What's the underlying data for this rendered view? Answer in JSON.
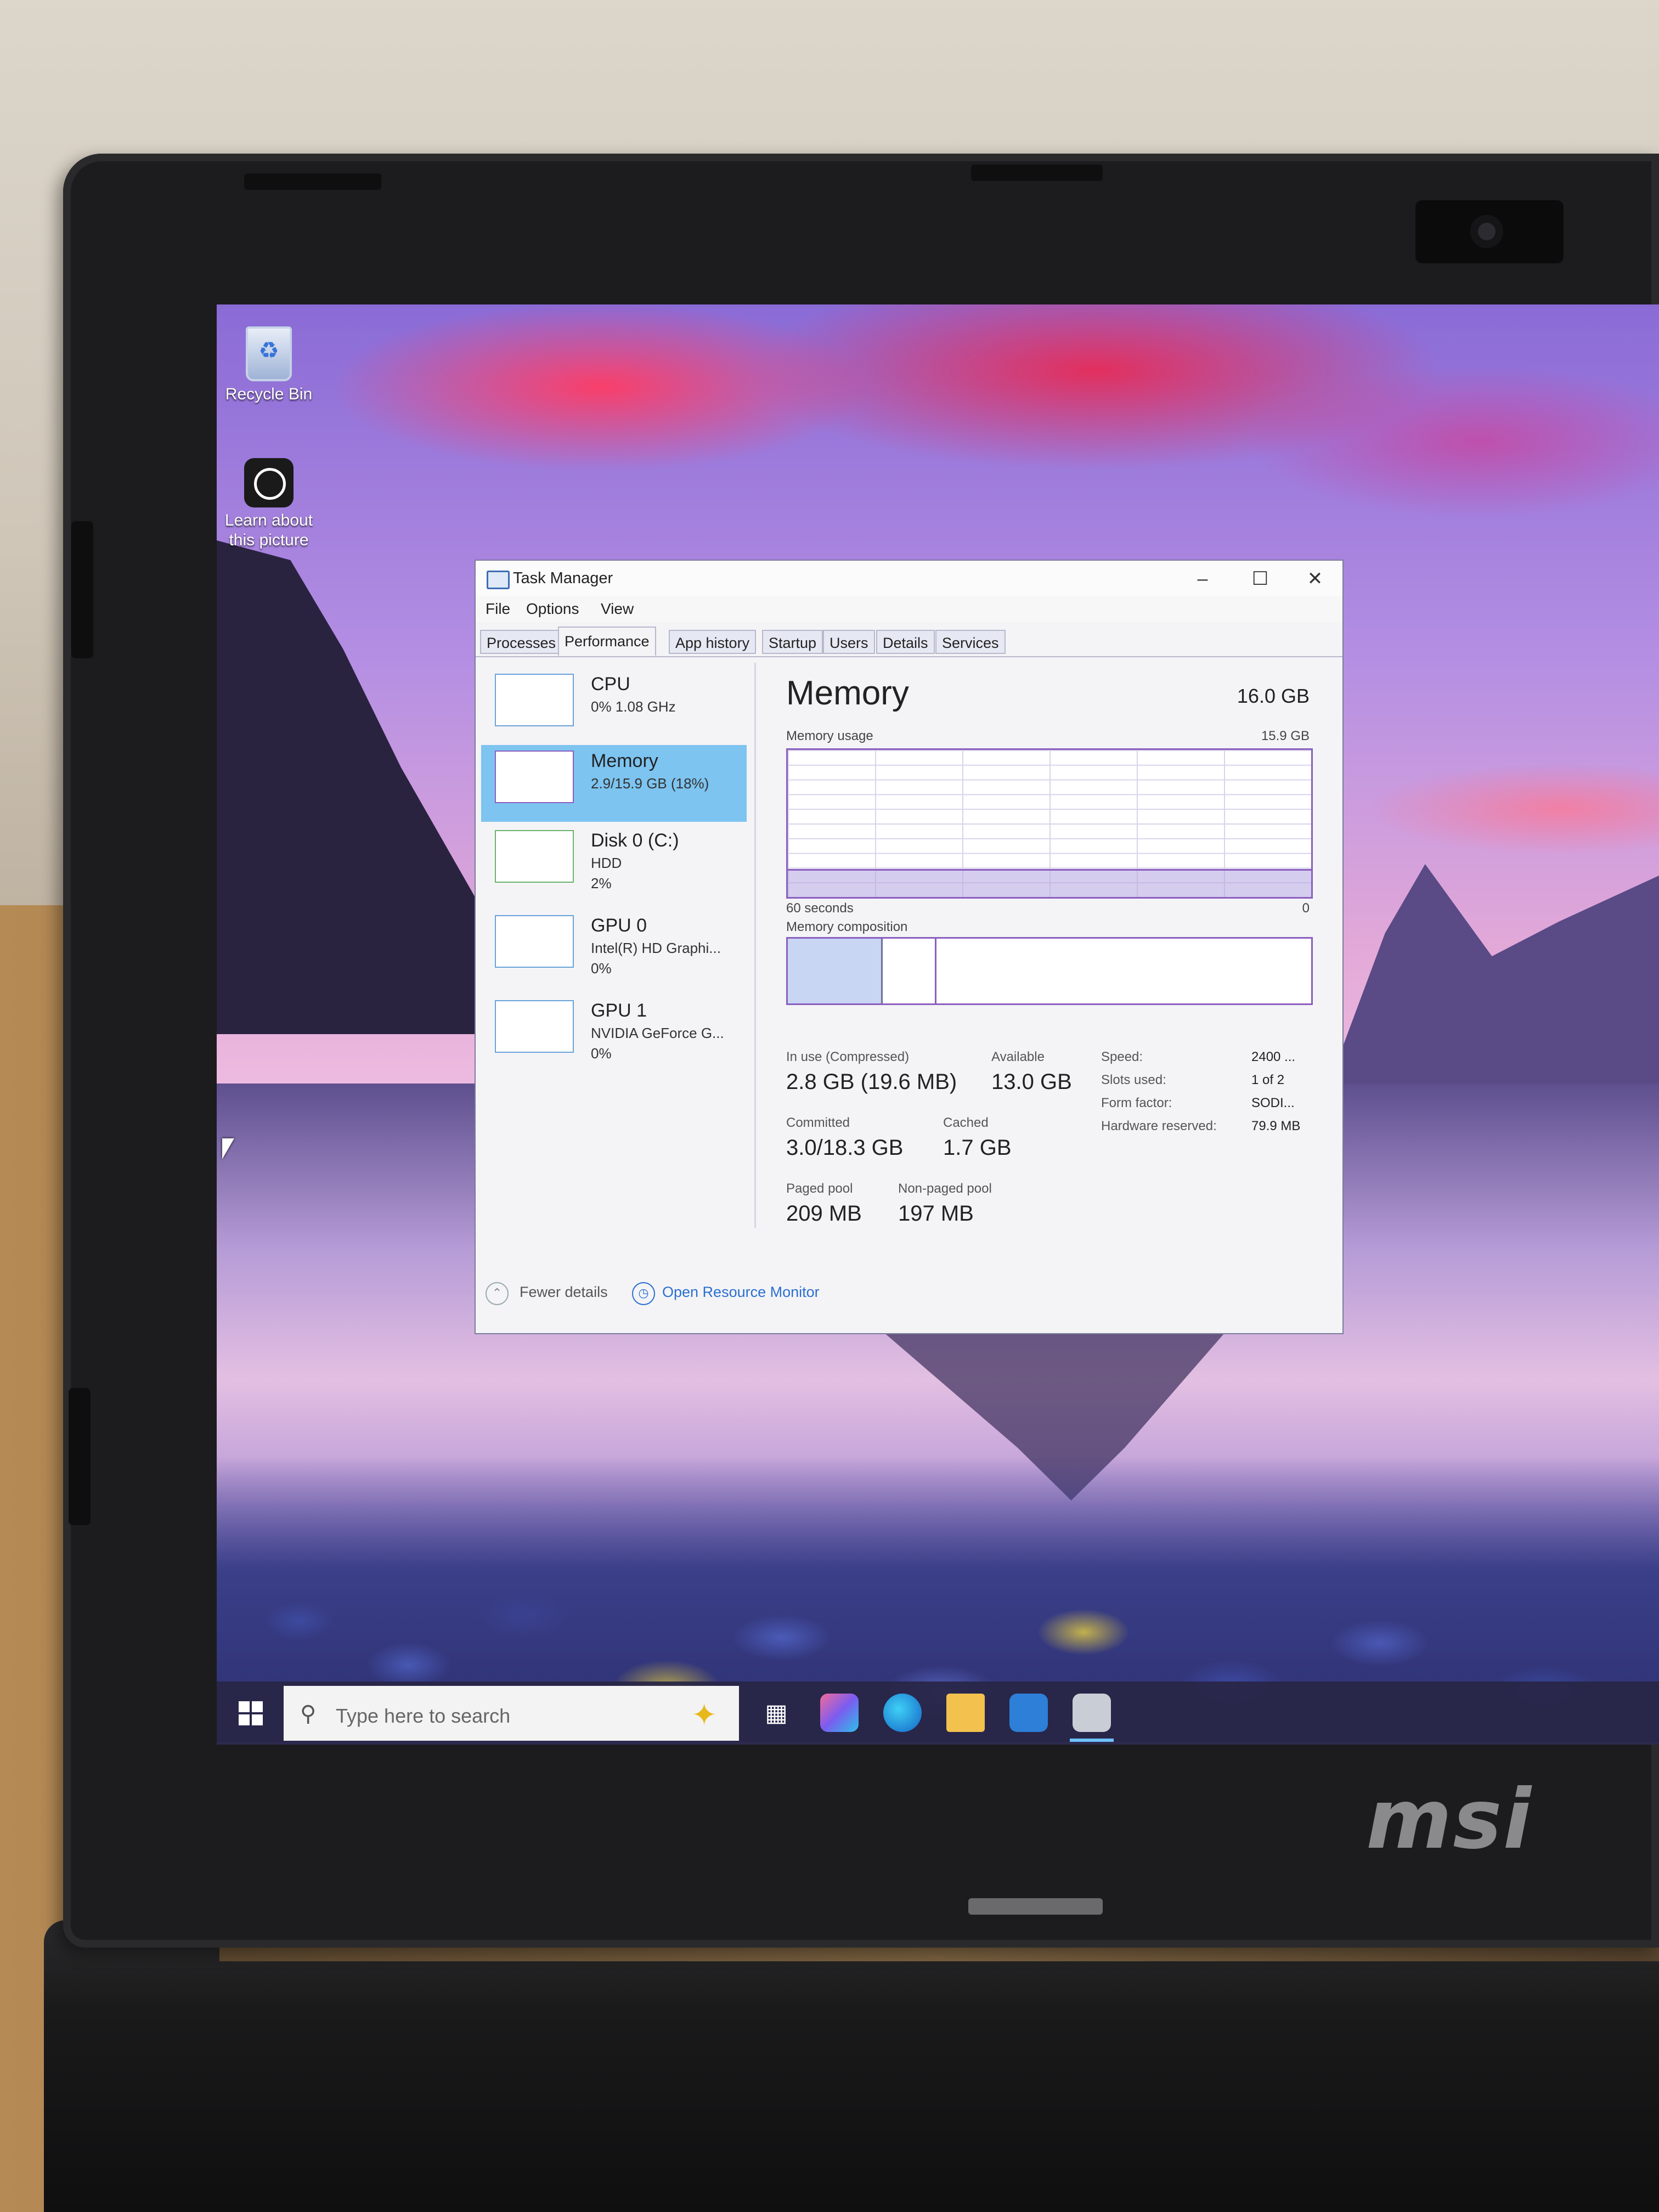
{
  "desktop": {
    "icons": [
      {
        "label": "Recycle Bin"
      },
      {
        "label": "Learn about this picture"
      }
    ]
  },
  "task_manager": {
    "title": "Task Manager",
    "menu": [
      "File",
      "Options",
      "View"
    ],
    "tabs": [
      "Processes",
      "Performance",
      "App history",
      "Startup",
      "Users",
      "Details",
      "Services"
    ],
    "active_tab": "Performance",
    "sidebar": [
      {
        "name": "CPU",
        "line1": "0% 1.08 GHz",
        "line2": ""
      },
      {
        "name": "Memory",
        "line1": "2.9/15.9 GB (18%)",
        "line2": "",
        "selected": true
      },
      {
        "name": "Disk 0 (C:)",
        "line1": "HDD",
        "line2": "2%"
      },
      {
        "name": "GPU 0",
        "line1": "Intel(R) HD Graphi...",
        "line2": "0%"
      },
      {
        "name": "GPU 1",
        "line1": "NVIDIA GeForce G...",
        "line2": "0%"
      }
    ],
    "memory": {
      "title": "Memory",
      "total": "16.0 GB",
      "usage_label": "Memory usage",
      "usage_max": "15.9 GB",
      "graph_left": "60 seconds",
      "graph_right": "0",
      "usage_fraction": 0.18,
      "composition_label": "Memory composition",
      "in_use_label": "In use (Compressed)",
      "in_use_value": "2.8 GB (19.6 MB)",
      "available_label": "Available",
      "available_value": "13.0 GB",
      "committed_label": "Committed",
      "committed_value": "3.0/18.3 GB",
      "cached_label": "Cached",
      "cached_value": "1.7 GB",
      "paged_label": "Paged pool",
      "paged_value": "209 MB",
      "nonpaged_label": "Non-paged pool",
      "nonpaged_value": "197 MB",
      "speed_label": "Speed:",
      "speed_value": "2400 ...",
      "slots_label": "Slots used:",
      "slots_value": "1 of 2",
      "form_label": "Form factor:",
      "form_value": "SODI...",
      "hwres_label": "Hardware reserved:",
      "hwres_value": "79.9 MB"
    },
    "footer": {
      "fewer_details": "Fewer details",
      "open_resource_monitor": "Open Resource Monitor"
    }
  },
  "taskbar": {
    "search_placeholder": "Type here to search"
  },
  "laptop": {
    "brand": "msi"
  },
  "colors": {
    "accent_selected": "#7dc4f0",
    "memory_graph": "#8b5fbf",
    "link": "#2a6fd0"
  }
}
